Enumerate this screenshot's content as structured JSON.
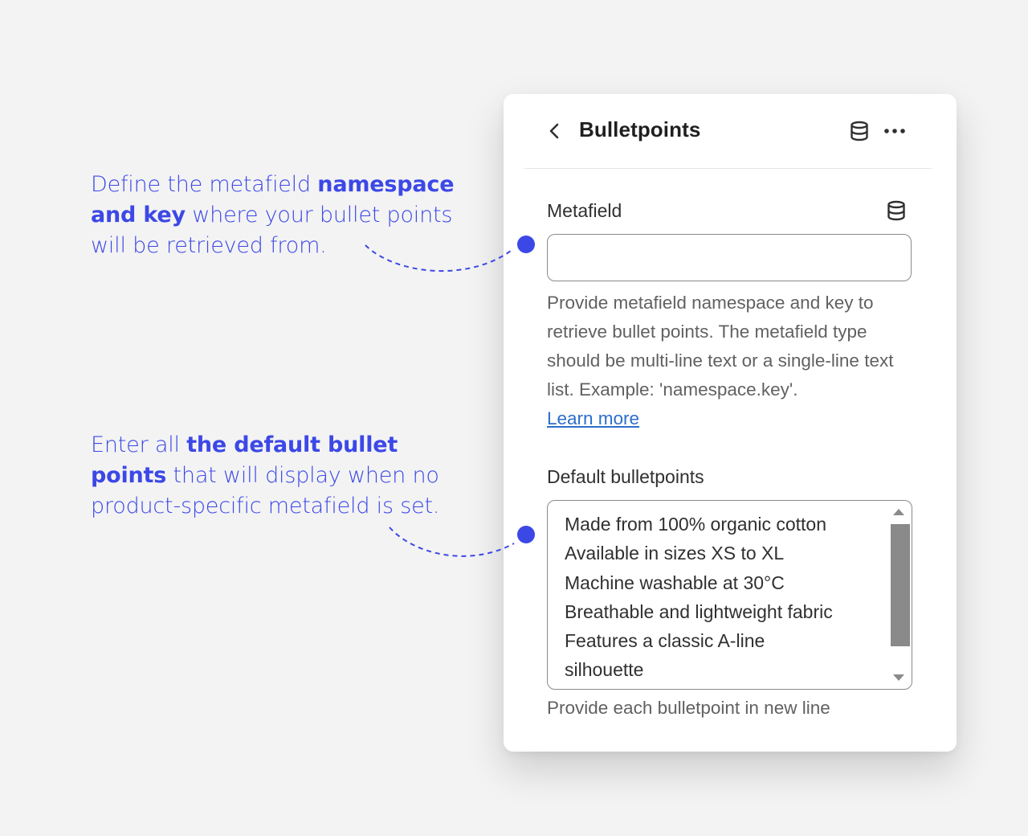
{
  "annotations": {
    "metafield": {
      "pre": "Define the metafield ",
      "bold": "namespace and key",
      "post": " where your bullet points will be retrieved from."
    },
    "default": {
      "pre": "Enter all ",
      "bold": "the default bullet points",
      "post": " that will display when no product-specific metafield is set."
    }
  },
  "colors": {
    "accent": "#3c48e6",
    "background": "#f3f3f3",
    "link": "#2c6ecb"
  },
  "panel": {
    "title": "Bulletpoints",
    "back_icon": "chevron-left-icon",
    "header_icons": [
      "database-icon",
      "more-horizontal-icon"
    ],
    "metafield": {
      "label": "Metafield",
      "icon": "database-icon",
      "value": "",
      "placeholder": "",
      "help": "Provide metafield namespace and key to retrieve bullet points. The metafield type should be multi-line text or a single-line text list. Example: 'namespace.key'.",
      "learn_more": "Learn more"
    },
    "default_bulletpoints": {
      "label": "Default bulletpoints",
      "lines": [
        "Made from 100% organic cotton",
        "Available in sizes XS to XL",
        "Machine washable at 30°C",
        "Breathable and lightweight fabric",
        "Features a classic A-line",
        "silhouette"
      ],
      "help": "Provide each bulletpoint in new line"
    }
  }
}
